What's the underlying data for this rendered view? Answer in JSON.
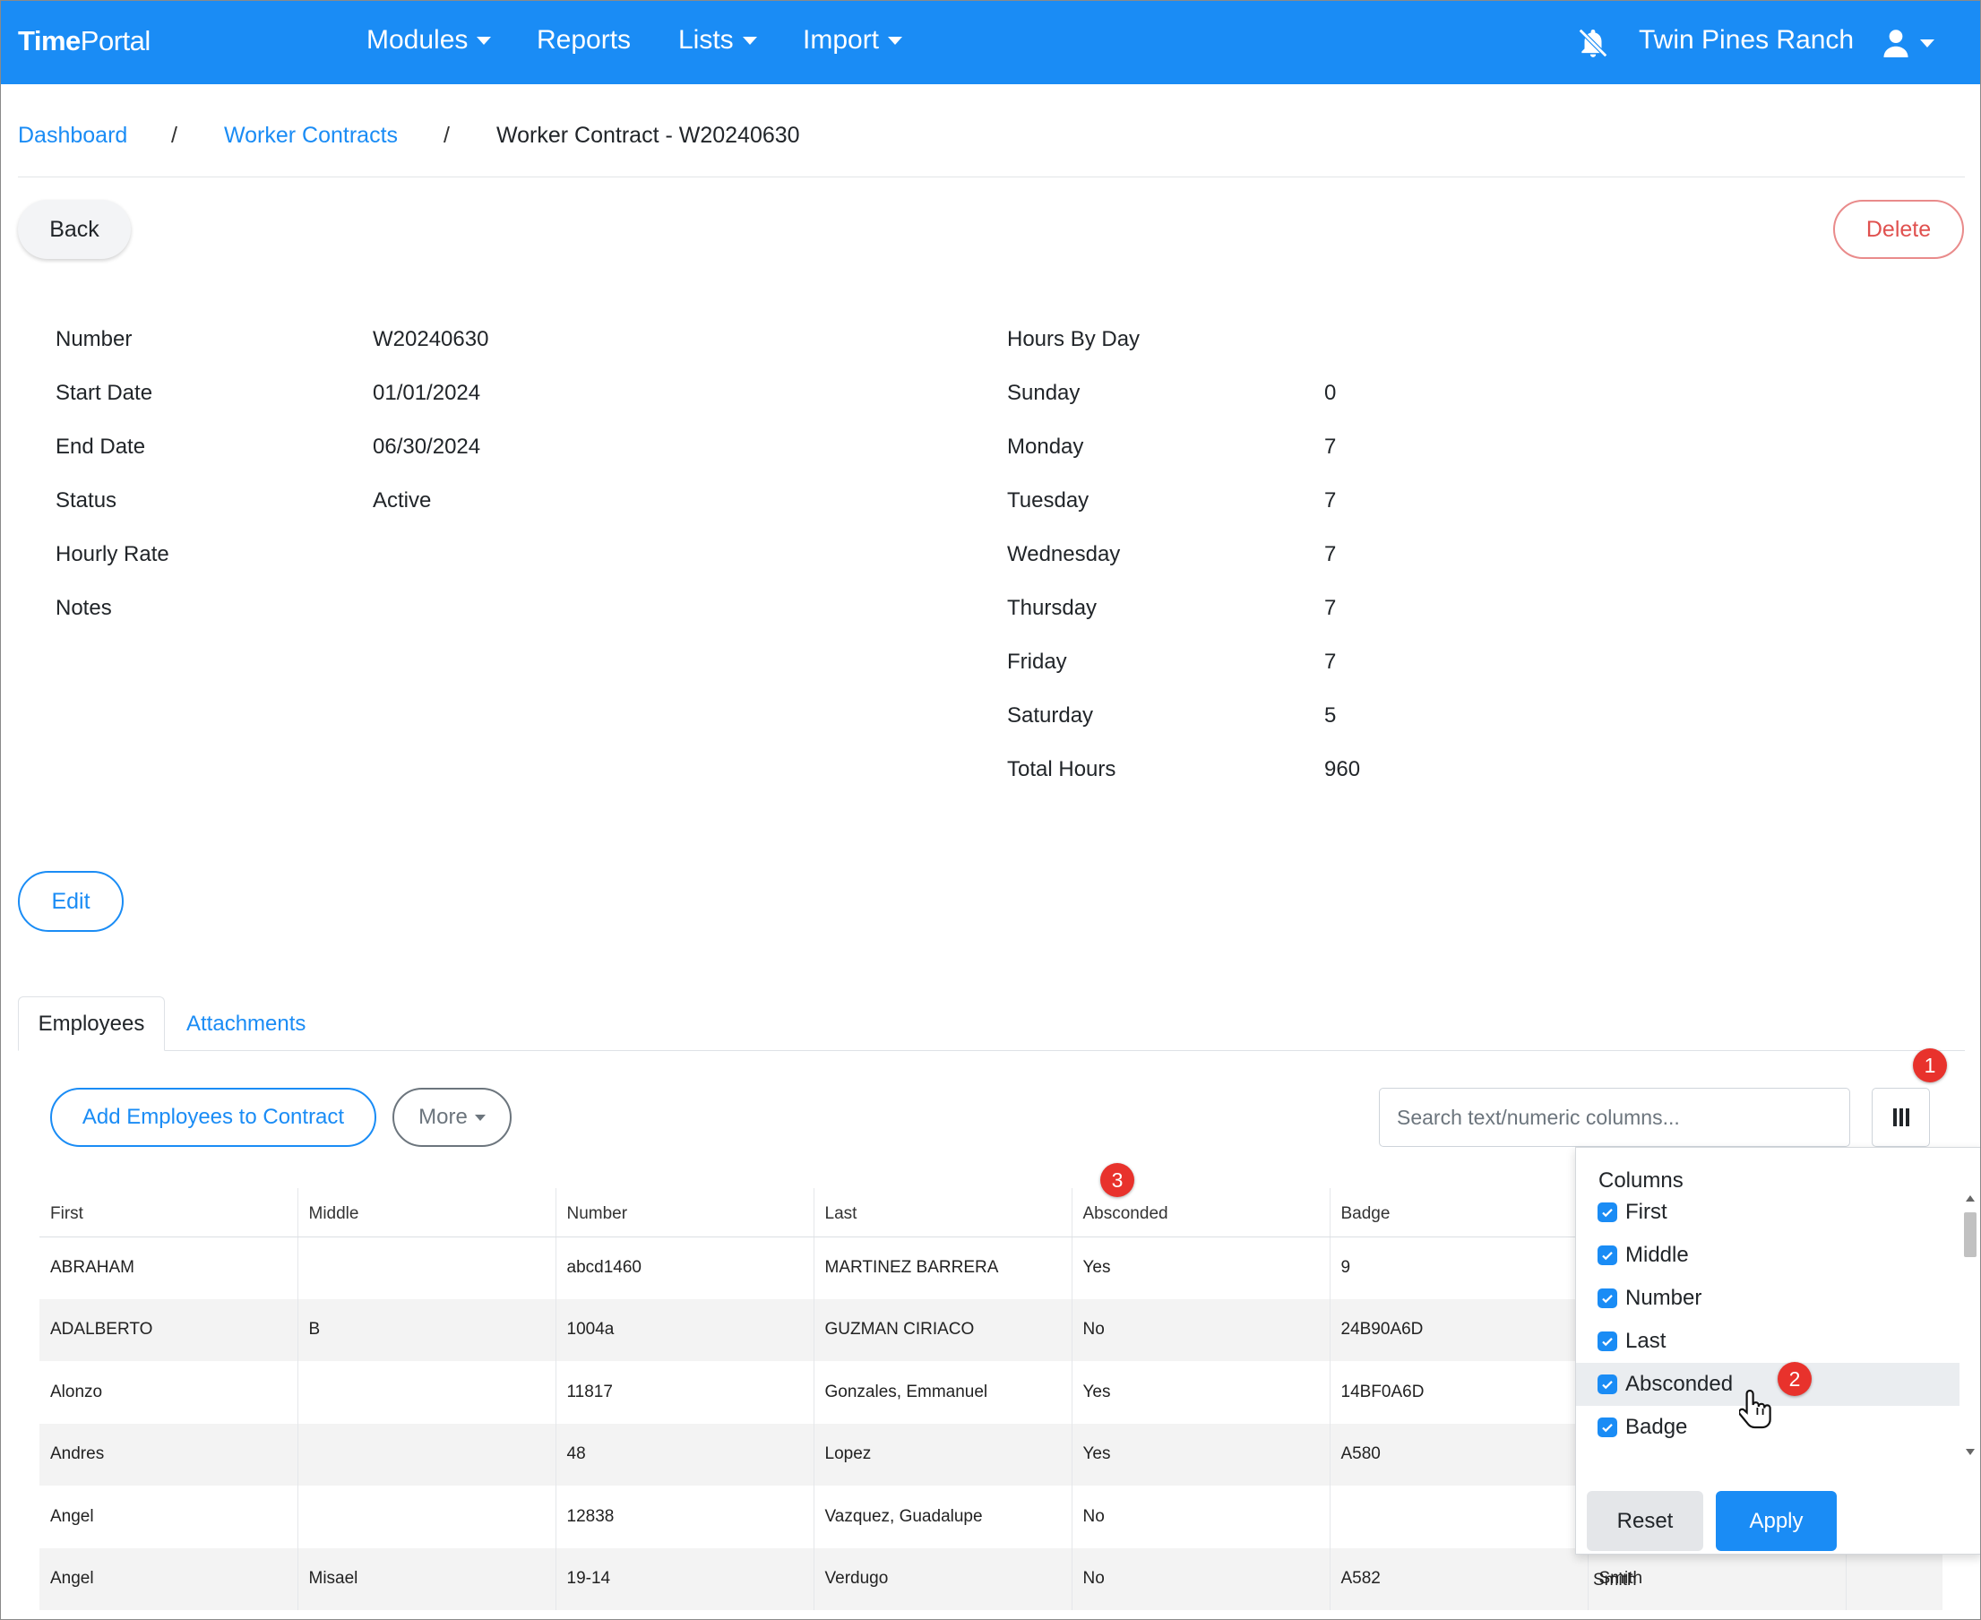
{
  "nav": {
    "brand_bold": "Time",
    "brand_rest": "Portal",
    "modules": "Modules",
    "reports": "Reports",
    "lists": "Lists",
    "import": "Import",
    "org": "Twin Pines Ranch"
  },
  "breadcrumb": {
    "dashboard": "Dashboard",
    "contracts": "Worker Contracts",
    "current": "Worker Contract - W20240630",
    "sep": "/"
  },
  "actions": {
    "back": "Back",
    "delete": "Delete",
    "edit": "Edit"
  },
  "details": [
    {
      "label": "Number",
      "value": "W20240630"
    },
    {
      "label": "Start Date",
      "value": "01/01/2024"
    },
    {
      "label": "End Date",
      "value": "06/30/2024"
    },
    {
      "label": "Status",
      "value": "Active"
    },
    {
      "label": "Hourly Rate",
      "value": ""
    },
    {
      "label": "Notes",
      "value": ""
    }
  ],
  "hours": {
    "title": "Hours By Day",
    "rows": [
      {
        "label": "Sunday",
        "value": "0"
      },
      {
        "label": "Monday",
        "value": "7"
      },
      {
        "label": "Tuesday",
        "value": "7"
      },
      {
        "label": "Wednesday",
        "value": "7"
      },
      {
        "label": "Thursday",
        "value": "7"
      },
      {
        "label": "Friday",
        "value": "7"
      },
      {
        "label": "Saturday",
        "value": "5"
      },
      {
        "label": "Total Hours",
        "value": "960"
      }
    ]
  },
  "tabs": {
    "employees": "Employees",
    "attachments": "Attachments"
  },
  "toolbar": {
    "add": "Add Employees to Contract",
    "more": "More",
    "search_placeholder": "Search text/numeric columns..."
  },
  "table": {
    "headers": [
      "First",
      "Middle",
      "Number",
      "Last",
      "Absconded",
      "Badge",
      "",
      ""
    ],
    "rows": [
      [
        "ABRAHAM",
        "",
        "abcd1460",
        "MARTINEZ BARRERA",
        "Yes",
        "9",
        "",
        ""
      ],
      [
        "ADALBERTO",
        "B",
        "1004a",
        "GUZMAN CIRIACO",
        "No",
        "24B90A6D",
        "",
        ""
      ],
      [
        "Alonzo",
        "",
        "11817",
        "Gonzales, Emmanuel",
        "Yes",
        "14BF0A6D",
        "",
        ""
      ],
      [
        "Andres",
        "",
        "48",
        "Lopez",
        "Yes",
        "A580",
        "",
        ""
      ],
      [
        "Angel",
        "",
        "12838",
        "Vazquez, Guadalupe",
        "No",
        "",
        "",
        ""
      ],
      [
        "Angel",
        "Misael",
        "19-14",
        "Verdugo",
        "No",
        "A582",
        "Smith",
        ""
      ]
    ]
  },
  "columns_menu": {
    "title": "Columns",
    "items": [
      "First",
      "Middle",
      "Number",
      "Last",
      "Absconded",
      "Badge"
    ],
    "reset": "Reset",
    "apply": "Apply"
  },
  "markers": [
    "1",
    "2",
    "3"
  ],
  "colors": {
    "primary": "#1a8cf5",
    "danger": "#e0514f",
    "marker": "#e8322c"
  }
}
